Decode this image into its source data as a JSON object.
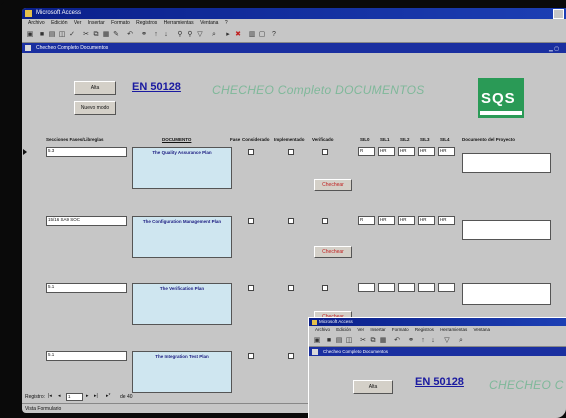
{
  "app": {
    "title": "Microsoft Access",
    "menu": [
      "Archivo",
      "Edición",
      "Ver",
      "Insertar",
      "Formato",
      "Registros",
      "Herramientas",
      "Ventana",
      "?"
    ],
    "form_title": "Checheo Completo Documentos"
  },
  "header": {
    "button_top": "Alta",
    "button_bottom": "Nuevo modo",
    "en_number": "EN 50128",
    "title": "CHECHEO Completo DOCUMENTOS",
    "logo_text": "SQS"
  },
  "columns": [
    "Secciones Fases/Libreglas",
    "DOCUMENTO",
    "Fase",
    "Considerado",
    "Implementado",
    "Verificado",
    "SIL0",
    "SIL1",
    "SIL2",
    "SIL3",
    "SIL4",
    "Documento del Proyecto"
  ],
  "rows": [
    {
      "section": "5.3",
      "document": "The Quality Assurance Plan",
      "sils": [
        "R",
        "HR",
        "HR",
        "HR",
        "HR"
      ],
      "button": "Chechear"
    },
    {
      "section": "15/16  SA9  SOC",
      "document": "The Configuration Management Plan",
      "sils": [
        "R",
        "HR",
        "HR",
        "HR",
        "HR"
      ],
      "button": "Chechear"
    },
    {
      "section": "5.1",
      "document": "The Verification Plan",
      "sils": [],
      "button": "Chechear"
    },
    {
      "section": "5.1",
      "document": "The Integration Test Plan",
      "sils": [],
      "button": ""
    }
  ],
  "nav": {
    "label": "Registro:",
    "current": "1",
    "total": "de 40"
  },
  "status": "Vista Formulario",
  "window2": {
    "title": "Microsoft Access",
    "form_title": "Checheo Completo Documentos",
    "button": "Alta",
    "en_number": "EN 50128",
    "title_text": "CHECHEO C"
  },
  "colors": {
    "accent": "#1a2fa0",
    "logo": "#2a9a56",
    "title_text": "#7fb89a",
    "doc_box": "#cfe6f0"
  }
}
